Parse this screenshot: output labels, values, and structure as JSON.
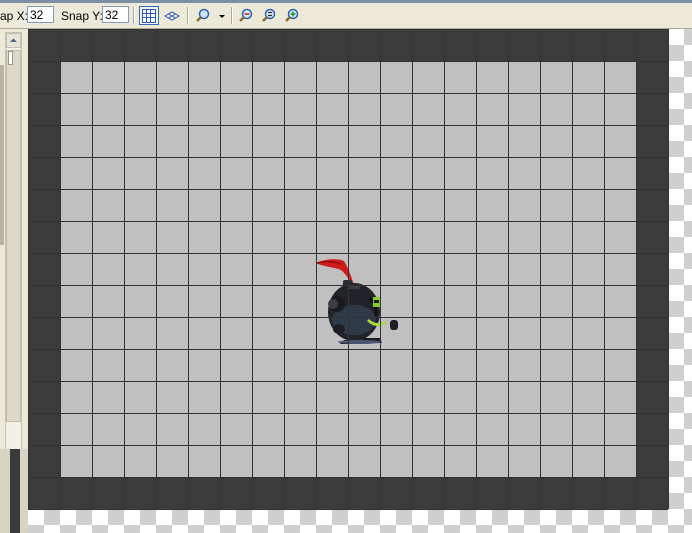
{
  "toolbar": {
    "snap_x_label": "ap X:",
    "snap_x_value": "32",
    "snap_y_label": "Snap Y:",
    "snap_y_value": "32",
    "buttons": [
      {
        "name": "toggle-grid-button",
        "icon": "grid-icon",
        "active": true
      },
      {
        "name": "isometric-grid-button",
        "icon": "isometric-grid-icon",
        "active": false
      },
      {
        "name": "zoom-menu-button",
        "icon": "magnifier-icon",
        "active": false
      },
      {
        "name": "zoom-out-button",
        "icon": "zoom-out-icon",
        "active": false
      },
      {
        "name": "zoom-reset-button",
        "icon": "zoom-reset-icon",
        "active": false
      },
      {
        "name": "zoom-in-button",
        "icon": "zoom-in-icon",
        "active": false
      }
    ]
  },
  "room": {
    "grid": {
      "cell": 32,
      "cols": 20,
      "rows": 15
    },
    "colors": {
      "wall": "#3b3b3b",
      "floor": "#c0c0c0",
      "grid_line": "#333333",
      "checker_light": "#ffffff",
      "checker_dark": "#cfcfcf"
    },
    "instances": [
      {
        "name": "knight-sprite",
        "object": "player-knight"
      }
    ]
  }
}
